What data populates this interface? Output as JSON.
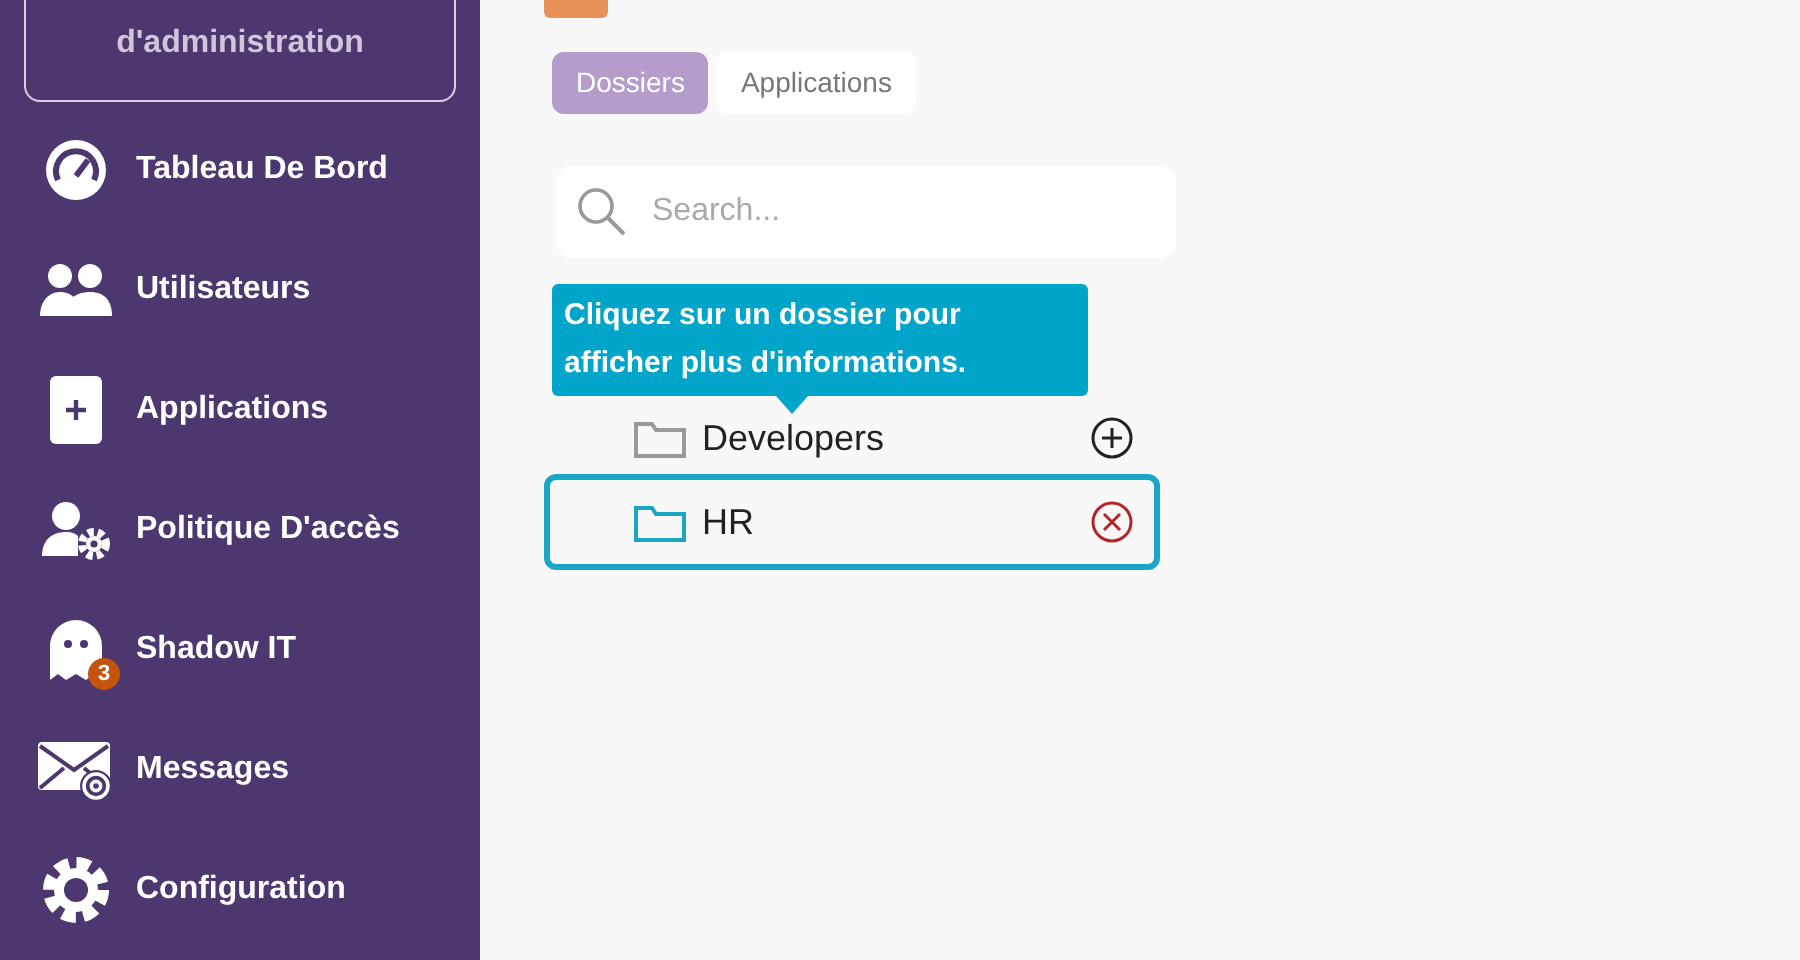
{
  "sidebar": {
    "header": {
      "lines": [
        "d'administration"
      ]
    },
    "items": [
      {
        "kind": "gauge",
        "label": "Tableau De Bord"
      },
      {
        "kind": "users",
        "label": "Utilisateurs"
      },
      {
        "kind": "plus",
        "label": "Applications"
      },
      {
        "kind": "usergear",
        "label": "Politique D'accès"
      },
      {
        "kind": "ghost",
        "label": "Shadow IT",
        "badge": "3"
      },
      {
        "kind": "mail",
        "label": "Messages"
      },
      {
        "kind": "gear",
        "label": "Configuration"
      }
    ]
  },
  "tabs": [
    {
      "label": "Dossiers",
      "selected": true
    },
    {
      "label": "Applications",
      "selected": false
    }
  ],
  "search": {
    "placeholder": "Search..."
  },
  "folders": [
    {
      "name": "Developers",
      "selected": false,
      "kind": "add"
    },
    {
      "name": "HR",
      "selected": true,
      "kind": "remove"
    }
  ],
  "tooltip": "Cliquez sur un dossier pour afficher plus d'informations."
}
